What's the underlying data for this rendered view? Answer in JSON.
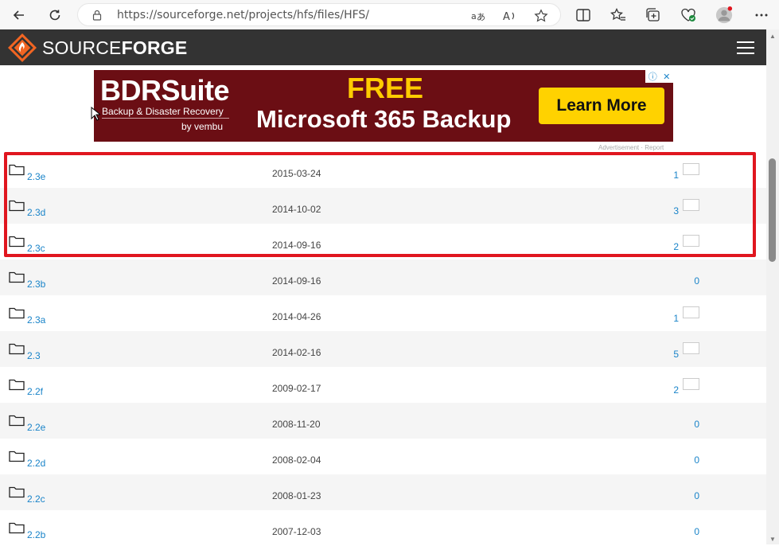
{
  "browser": {
    "url": "https://sourceforge.net/projects/hfs/files/HFS/"
  },
  "site": {
    "brand_light": "SOURCE",
    "brand_bold": "FORGE"
  },
  "ad": {
    "brand": "BDRSuite",
    "tagline": "Backup & Disaster Recovery",
    "by": "by vembu",
    "headline": "FREE",
    "product": "Microsoft 365 Backup",
    "cta": "Learn More",
    "meta": "Advertisement · Report"
  },
  "files": [
    {
      "name": "2.3e",
      "date": "2015-03-24",
      "count": "1"
    },
    {
      "name": "2.3d",
      "date": "2014-10-02",
      "count": "3"
    },
    {
      "name": "2.3c",
      "date": "2014-09-16",
      "count": "2"
    },
    {
      "name": "2.3b",
      "date": "2014-09-16",
      "count": "0"
    },
    {
      "name": "2.3a",
      "date": "2014-04-26",
      "count": "1"
    },
    {
      "name": "2.3",
      "date": "2014-02-16",
      "count": "5"
    },
    {
      "name": "2.2f",
      "date": "2009-02-17",
      "count": "2"
    },
    {
      "name": "2.2e",
      "date": "2008-11-20",
      "count": "0"
    },
    {
      "name": "2.2d",
      "date": "2008-02-04",
      "count": "0"
    },
    {
      "name": "2.2c",
      "date": "2008-01-23",
      "count": "0"
    },
    {
      "name": "2.2b",
      "date": "2007-12-03",
      "count": "0"
    }
  ],
  "colors": {
    "link": "#1a84c9",
    "header": "#333333",
    "highlight": "#e0161f",
    "brand_orange": "#f26522"
  }
}
